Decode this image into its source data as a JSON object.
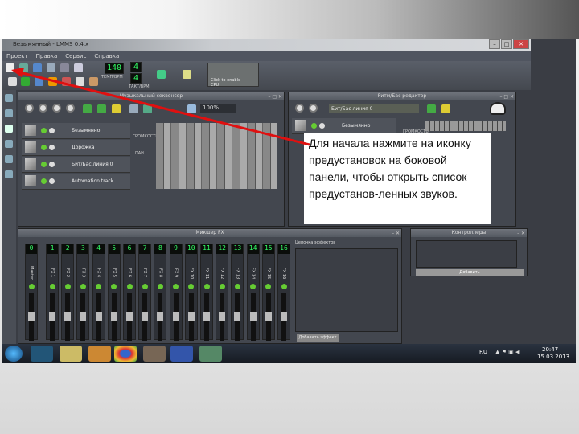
{
  "window": {
    "title": "Безымянный - LMMS 0.4.x"
  },
  "menu": [
    "Проект",
    "Правка",
    "Сервис",
    "Справка"
  ],
  "toolbar": {
    "tempo": "140",
    "tempo_label": "ТЕМП/BPM",
    "sig_num": "4",
    "sig_den": "4",
    "sig_label": "ТАКТ/BPM",
    "cpu_hint": "Click to enable",
    "cpu_label": "CPU"
  },
  "song_editor": {
    "title": "Музыкальный секвенсор",
    "zoom": "100%",
    "tracks": [
      {
        "name": "Безымянно"
      },
      {
        "name": "Дорожка"
      },
      {
        "name": "Бит/Бас линия 0"
      },
      {
        "name": "Automation track"
      }
    ],
    "knob_labels": [
      "ГРОМКОСТЬ",
      "ПАН"
    ]
  },
  "bb_editor": {
    "title": "Ритм/Бас редактор",
    "pattern": "Бит/Бас линия 0",
    "track": "Безымянно",
    "knob_label": "ГРОМКОСТЬ"
  },
  "mixer": {
    "title": "Микшер FX",
    "channels": [
      "0",
      "1",
      "2",
      "3",
      "4",
      "5",
      "6",
      "7",
      "8",
      "9",
      "10",
      "11",
      "12",
      "13",
      "14",
      "15",
      "16"
    ],
    "labels": [
      "Master",
      "FX 1",
      "FX 2",
      "FX 3",
      "FX 4",
      "FX 5",
      "FX 6",
      "FX 7",
      "FX 8",
      "FX 9",
      "FX 10",
      "FX 11",
      "FX 12",
      "FX 13",
      "FX 14",
      "FX 15",
      "FX 16"
    ],
    "effects_chain": "Цепочка эффектов",
    "add_effect": "Добавить эффект"
  },
  "controllers": {
    "title": "Контроллеры",
    "add": "Добавить"
  },
  "taskbar": {
    "lang": "RU",
    "time": "20:47",
    "date": "15.03.2013"
  },
  "caption": "Для начала нажмите на иконку предустановок на боковой панели, чтобы открыть список предустанов-ленных звуков.",
  "colors": {
    "arrow": "#e01010",
    "lcd": "#33ff66"
  }
}
